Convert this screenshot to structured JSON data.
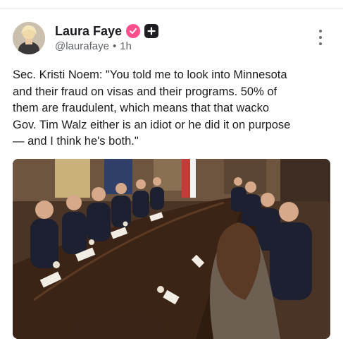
{
  "post": {
    "author": {
      "display_name": "Laura Faye",
      "handle": "@laurafaye",
      "verified_icon": "verified-badge-icon",
      "badge_icon": "plus-badge-icon",
      "accent_color": "#ff4f8b"
    },
    "separator": "•",
    "timestamp": "1h",
    "text": "Sec. Kristi Noem: \"You told me to look into Minnesota\nand their fraud on visas and their programs. 50% of\nthem are fraudulent, which means that that wacko\nGov. Tim Walz either is an idiot or he did it on purpose\n— and I think he's both.\"",
    "more_icon": "more-vertical-icon",
    "media": {
      "kind": "video-still",
      "description_icon": "cabinet-meeting-image"
    }
  }
}
